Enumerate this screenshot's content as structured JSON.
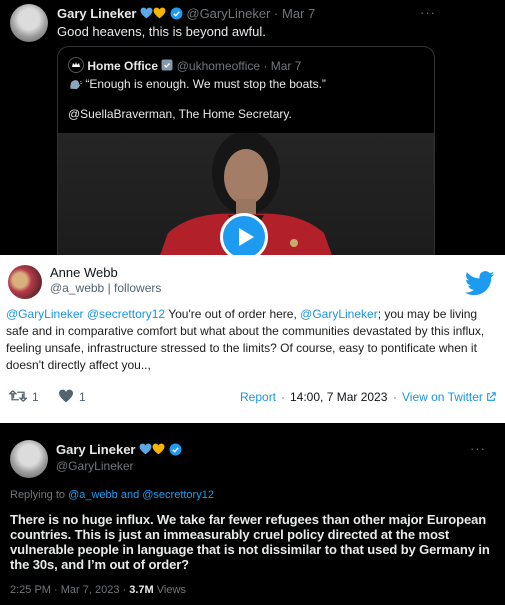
{
  "tweet1": {
    "name": "Gary Lineker",
    "handle": "@GaryLineker",
    "date": "Mar 7",
    "more": "···",
    "text": "Good heavens, this is beyond awful."
  },
  "quote": {
    "name": "Home Office",
    "handle": "@ukhomeoffice",
    "date": "Mar 7",
    "line1": "“Enough is enough. We must stop the boats.”",
    "line2": "@SuellaBraverman, The Home Secretary."
  },
  "card": {
    "name": "Anne Webb",
    "handle": "@a_webb",
    "followers": "followers",
    "body_mentions": "@GaryLineker @secrettory12",
    "body1": " You're out of order here, ",
    "body_mention2": "@GaryLineker",
    "body2": "; you may be living safe and in comparative comfort but what about the communities devastated by this influx, feeling unsafe, infrastructure stressed to the limits? Of course, easy to pontificate when it doesn't directly affect you..,",
    "retweets": "1",
    "likes": "1",
    "report": "Report",
    "timestamp": "14:00, 7 Mar 2023",
    "view_link": "View on Twitter"
  },
  "reply": {
    "name": "Gary Lineker",
    "handle": "@GaryLineker",
    "more": "···",
    "replying_prefix": "Replying to ",
    "replying_users": "@a_webb and @secrettory12",
    "text": "There is no huge influx. We take far fewer refugees than other major European countries. This is just an immeasurably cruel policy directed at the most vulnerable people in language that is not dissimilar to that used by Germany in the 30s, and I’m out of order?",
    "time": "2:25 PM · Mar 7, 2023 · ",
    "views_count": "3.7M",
    "views_label": " Views"
  },
  "colors": {
    "accent": "#1d9bf0",
    "verified_gold": "#f7b500",
    "gray": "#71767b",
    "card_bg": "#ffffff"
  }
}
